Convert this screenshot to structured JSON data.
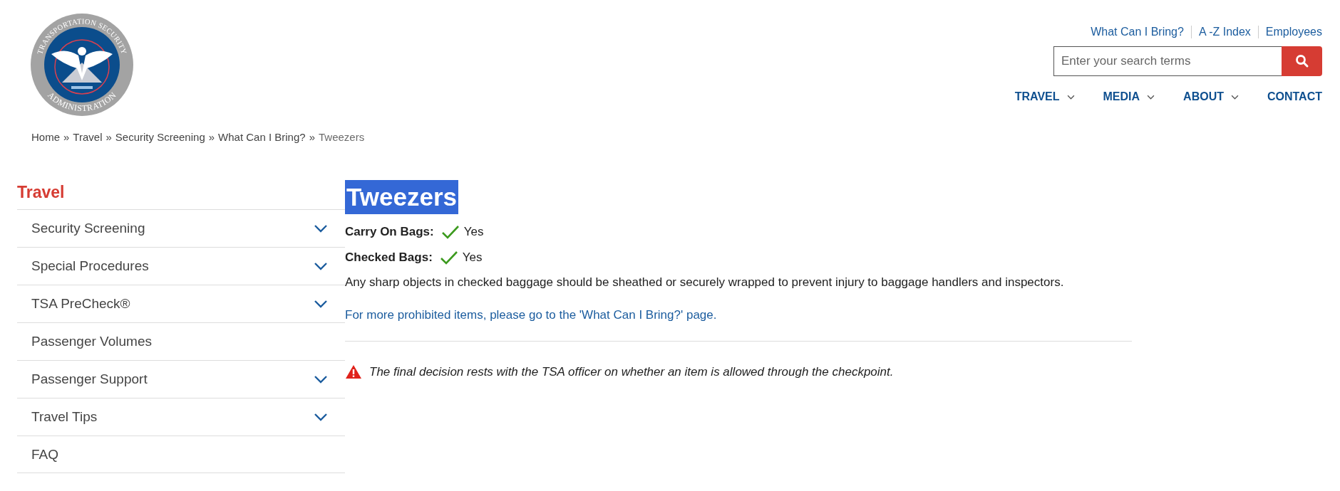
{
  "logo": {
    "top_text": "TRANSPORTATION SECURITY",
    "bottom_text": "ADMINISTRATION"
  },
  "utility_links": [
    "What Can I Bring?",
    "A -Z Index",
    "Employees"
  ],
  "search": {
    "placeholder": "Enter your search terms"
  },
  "main_nav": [
    {
      "label": "TRAVEL",
      "dropdown": true
    },
    {
      "label": "MEDIA",
      "dropdown": true
    },
    {
      "label": "ABOUT",
      "dropdown": true
    },
    {
      "label": "CONTACT",
      "dropdown": false
    }
  ],
  "breadcrumb": [
    {
      "label": "Home",
      "current": false
    },
    {
      "label": "Travel",
      "current": false
    },
    {
      "label": "Security Screening",
      "current": false
    },
    {
      "label": "What Can I Bring?",
      "current": false
    },
    {
      "label": "Tweezers",
      "current": true
    }
  ],
  "breadcrumb_separator": "»",
  "sidebar": {
    "title": "Travel",
    "items": [
      {
        "label": "Security Screening",
        "expandable": true
      },
      {
        "label": "Special Procedures",
        "expandable": true
      },
      {
        "label": "TSA PreCheck®",
        "expandable": true
      },
      {
        "label": "Passenger Volumes",
        "expandable": false
      },
      {
        "label": "Passenger Support",
        "expandable": true
      },
      {
        "label": "Travel Tips",
        "expandable": true
      },
      {
        "label": "FAQ",
        "expandable": false
      }
    ]
  },
  "content": {
    "title": "Tweezers",
    "title_highlighted": true,
    "rules": [
      {
        "label": "Carry On Bags:",
        "allowed": true,
        "answer": "Yes"
      },
      {
        "label": "Checked Bags:",
        "allowed": true,
        "answer": "Yes"
      }
    ],
    "description": "Any sharp objects in checked baggage should be sheathed or securely wrapped to prevent injury to baggage handlers and inspectors.",
    "more_link": "For more prohibited items, please go to the 'What Can I Bring?' page.",
    "warning": "The final decision rests with the TSA officer on whether an item is allowed through the checkpoint."
  }
}
